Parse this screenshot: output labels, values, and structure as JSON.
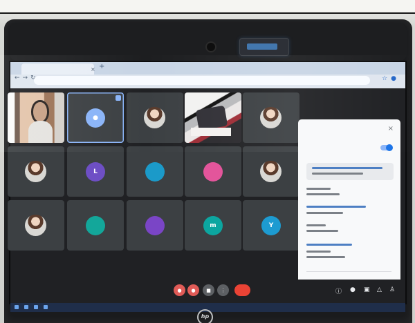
{
  "photo": {
    "description_colors": {
      "screen_bg": "#202124",
      "accent": "#8ab4f8",
      "end_call": "#ea4335"
    },
    "top_text": "",
    "tiles": [
      {
        "name": "",
        "avatar": "main-photo",
        "color": "#e3c4aa"
      },
      {
        "name": "",
        "avatar": "person-icon",
        "color": "#8ab4f8"
      },
      {
        "name": "",
        "avatar": "profile-photo",
        "color": "#7d8f9f"
      },
      {
        "name": "",
        "avatar": "screen-share",
        "color": "#b9babc"
      },
      {
        "name": "",
        "avatar": "profile-photo",
        "color": "#d9d8d4"
      },
      {
        "name": "",
        "avatar": "profile-photo",
        "color": "#c8b0a0"
      },
      {
        "name": "",
        "avatar": "L",
        "color": "#6e4fc5"
      },
      {
        "name": "",
        "avatar": "",
        "color": "#1b9ac9"
      },
      {
        "name": "",
        "avatar": "",
        "color": "#e3559b"
      },
      {
        "name": "",
        "avatar": "profile-photo",
        "color": "#d9d8d4"
      },
      {
        "name": "",
        "avatar": "profile-photo",
        "color": "#d7c3b5"
      },
      {
        "name": "",
        "avatar": "",
        "color": "#13a79a"
      },
      {
        "name": "",
        "avatar": "",
        "color": "#7a45c6"
      },
      {
        "name": "",
        "avatar": "m",
        "color": "#0ca6a0"
      },
      {
        "name": "",
        "avatar": "Y",
        "color": "#1d9bd1"
      }
    ]
  }
}
